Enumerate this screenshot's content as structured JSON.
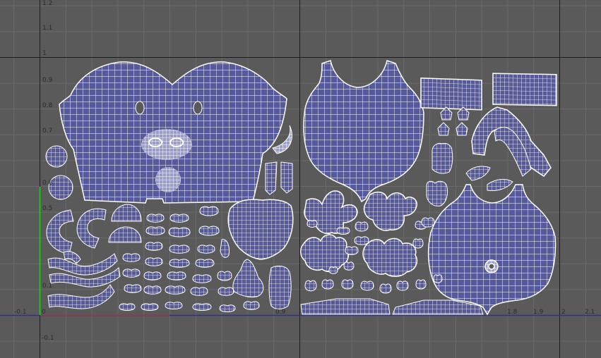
{
  "editor": {
    "view": "uv-texture-editor",
    "colors": {
      "background": "#5a5a5a",
      "grid_minor": "#6a6a6a",
      "grid_major": "#1e1e1e",
      "u_axis": "#2a2fb0",
      "v_axis": "#1fd01f",
      "origin_u": "#c62828",
      "shell_fill": "#56599a",
      "wire": "#ffffff",
      "tick_text": "#2b2b2b"
    },
    "v_ticks": [
      "1.2",
      "1.1",
      "1",
      "0.9",
      "0.8",
      "0.7",
      "0.6",
      "0.5",
      "0.1",
      "0",
      "-0.1"
    ],
    "u_ticks": [
      "-0.1",
      "0",
      "0.9",
      "1.8",
      "1.9",
      "2",
      "2.1"
    ]
  }
}
